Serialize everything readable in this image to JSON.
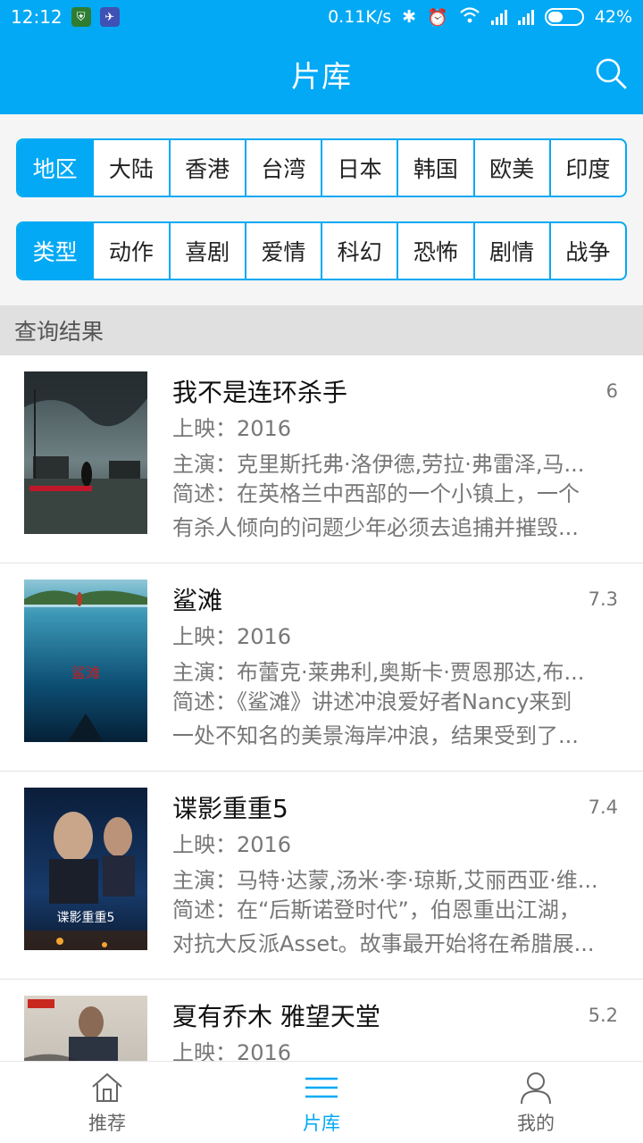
{
  "status_bar": {
    "time": "12:12",
    "speed": "0.11K/s",
    "battery": "42%"
  },
  "app_bar": {
    "title": "片库"
  },
  "filters": {
    "region": {
      "label": "地区",
      "options": [
        "大陆",
        "香港",
        "台湾",
        "日本",
        "韩国",
        "欧美",
        "印度"
      ]
    },
    "genre": {
      "label": "类型",
      "options": [
        "动作",
        "喜剧",
        "爱情",
        "科幻",
        "恐怖",
        "剧情",
        "战争"
      ]
    }
  },
  "results_header": "查询结果",
  "labels": {
    "release": "上映：",
    "cast": "主演：",
    "desc": "简述："
  },
  "movies": [
    {
      "title": "我不是连环杀手",
      "rating": "6",
      "year": "2016",
      "cast": "克里斯托弗·洛伊德,劳拉·弗雷泽,马...",
      "desc1": "在英格兰中西部的一个小镇上，一个",
      "desc2": "有杀人倾向的问题少年必须去追捕并摧毁..."
    },
    {
      "title": "鲨滩",
      "rating": "7.3",
      "year": "2016",
      "cast": "布蕾克·莱弗利,奥斯卡·贾恩那达,布...",
      "desc1": "《鲨滩》讲述冲浪爱好者Nancy来到",
      "desc2": "一处不知名的美景海岸冲浪，结果受到了..."
    },
    {
      "title": "谍影重重5",
      "rating": "7.4",
      "year": "2016",
      "cast": "马特·达蒙,汤米·李·琼斯,艾丽西亚·维...",
      "desc1": "在“后斯诺登时代”，伯恩重出江湖，",
      "desc2": "对抗大反派Asset。故事最开始将在希腊展..."
    },
    {
      "title": "夏有乔木 雅望天堂",
      "rating": "5.2",
      "year": "2016",
      "cast": "",
      "desc1": "",
      "desc2": ""
    }
  ],
  "bottom_nav": [
    {
      "label": "推荐",
      "icon": "home-icon"
    },
    {
      "label": "片库",
      "icon": "list-icon"
    },
    {
      "label": "我的",
      "icon": "person-icon"
    }
  ],
  "colors": {
    "accent": "#03a9f4",
    "result_header_bg": "#e0e0e0"
  }
}
